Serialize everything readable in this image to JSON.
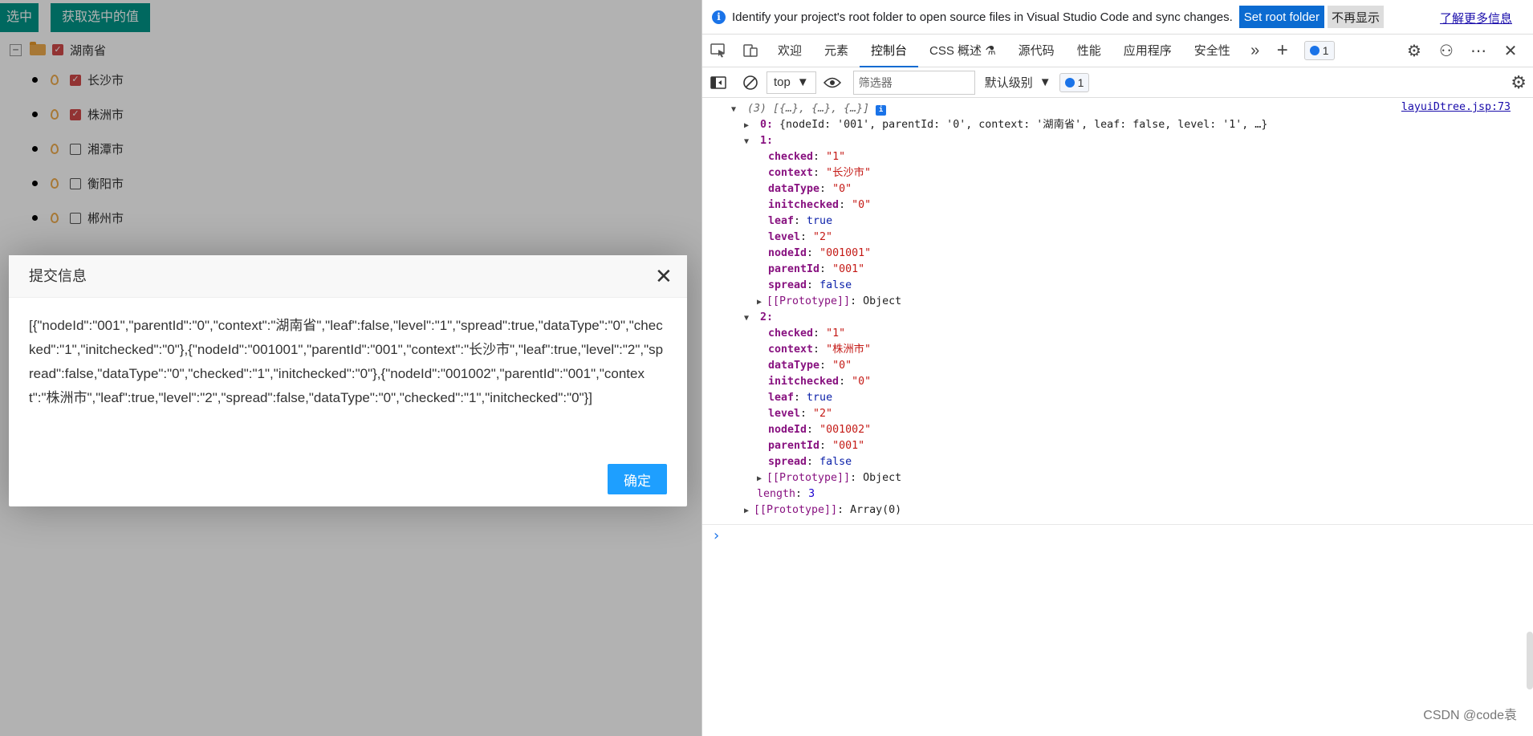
{
  "left": {
    "buttons": {
      "select": "选中",
      "get_selected": "获取选中的值"
    },
    "tree": {
      "root": {
        "label": "湖南省",
        "toggle": "−",
        "checked": true
      },
      "children": [
        {
          "label": "长沙市",
          "checked": true
        },
        {
          "label": "株洲市",
          "checked": true
        },
        {
          "label": "湘潭市",
          "checked": false
        },
        {
          "label": "衡阳市",
          "checked": false
        },
        {
          "label": "郴州市",
          "checked": false
        }
      ]
    },
    "dialog": {
      "title": "提交信息",
      "close": "✕",
      "body": "[{\"nodeId\":\"001\",\"parentId\":\"0\",\"context\":\"湖南省\",\"leaf\":false,\"level\":\"1\",\"spread\":true,\"dataType\":\"0\",\"checked\":\"1\",\"initchecked\":\"0\"},{\"nodeId\":\"001001\",\"parentId\":\"001\",\"context\":\"长沙市\",\"leaf\":true,\"level\":\"2\",\"spread\":false,\"dataType\":\"0\",\"checked\":\"1\",\"initchecked\":\"0\"},{\"nodeId\":\"001002\",\"parentId\":\"001\",\"context\":\"株洲市\",\"leaf\":true,\"level\":\"2\",\"spread\":false,\"dataType\":\"0\",\"checked\":\"1\",\"initchecked\":\"0\"}]",
      "ok": "确定"
    }
  },
  "devtools": {
    "infobar": {
      "text": "Identify your project's root folder to open source files in Visual Studio Code and sync changes.",
      "set_root": "Set root folder",
      "dismiss": "不再显示",
      "learn_more": "了解更多信息"
    },
    "tabs": [
      "欢迎",
      "元素",
      "控制台",
      "CSS 概述 ⚗",
      "源代码",
      "性能",
      "应用程序",
      "安全性"
    ],
    "active_tab": "控制台",
    "issue_count": "1",
    "toolbar": {
      "context": "top",
      "filter_placeholder": "筛选器",
      "level": "默认级别",
      "issue_count": "1"
    },
    "console": {
      "source_link": "layuiDtree.jsp:73",
      "summary": "(3) [{…}, {…}, {…}]",
      "item0": "{nodeId: '001', parentId: '0', context: '湖南省', leaf: false, level: '1', …}",
      "items": [
        {
          "index": "1:",
          "checked": "\"1\"",
          "context": "\"长沙市\"",
          "dataType": "\"0\"",
          "initchecked": "\"0\"",
          "leaf": "true",
          "level": "\"2\"",
          "nodeId": "\"001001\"",
          "parentId": "\"001\"",
          "spread": "false",
          "prototype": "Object"
        },
        {
          "index": "2:",
          "checked": "\"1\"",
          "context": "\"株洲市\"",
          "dataType": "\"0\"",
          "initchecked": "\"0\"",
          "leaf": "true",
          "level": "\"2\"",
          "nodeId": "\"001002\"",
          "parentId": "\"001\"",
          "spread": "false",
          "prototype": "Object"
        }
      ],
      "length": "3",
      "array_proto": "Array(0)"
    },
    "watermark": "CSDN @code袁"
  }
}
